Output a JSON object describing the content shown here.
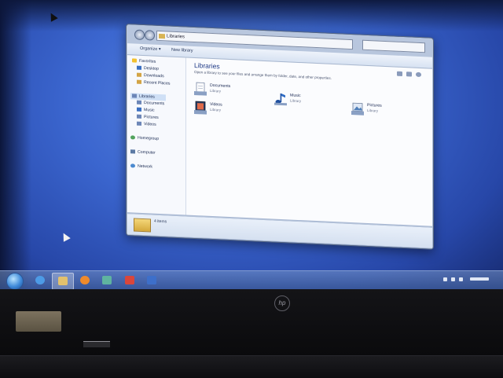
{
  "window": {
    "address": "Libraries",
    "toolbar": {
      "organize_label": "Organize ▾",
      "new_library_label": "New library"
    },
    "nav": {
      "favorites": "Favorites",
      "desktop": "Desktop",
      "downloads": "Downloads",
      "recent_places": "Recent Places",
      "libraries": "Libraries",
      "documents": "Documents",
      "music": "Music",
      "pictures": "Pictures",
      "videos": "Videos",
      "homegroup": "Homegroup",
      "computer": "Computer",
      "network": "Network"
    },
    "content": {
      "title": "Libraries",
      "subtitle": "Open a library to see your files and arrange them by folder, date, and other properties.",
      "items": [
        {
          "name": "Documents",
          "type": "Library"
        },
        {
          "name": "Music",
          "type": "Library"
        },
        {
          "name": "Pictures",
          "type": "Library"
        },
        {
          "name": "Videos",
          "type": "Library"
        }
      ]
    },
    "status": "4 items"
  },
  "taskbar": {
    "icons": [
      "start-orb-icon",
      "internet-explorer-icon",
      "file-explorer-icon",
      "media-player-icon",
      "media-center-icon",
      "snipping-tool-icon",
      "network-tool-icon"
    ]
  },
  "bezel": {
    "brand": "hp"
  },
  "colors": {
    "desktop": "#3b66cf",
    "title_text": "#1f3a86",
    "taskbar": "#4a6aa8"
  }
}
